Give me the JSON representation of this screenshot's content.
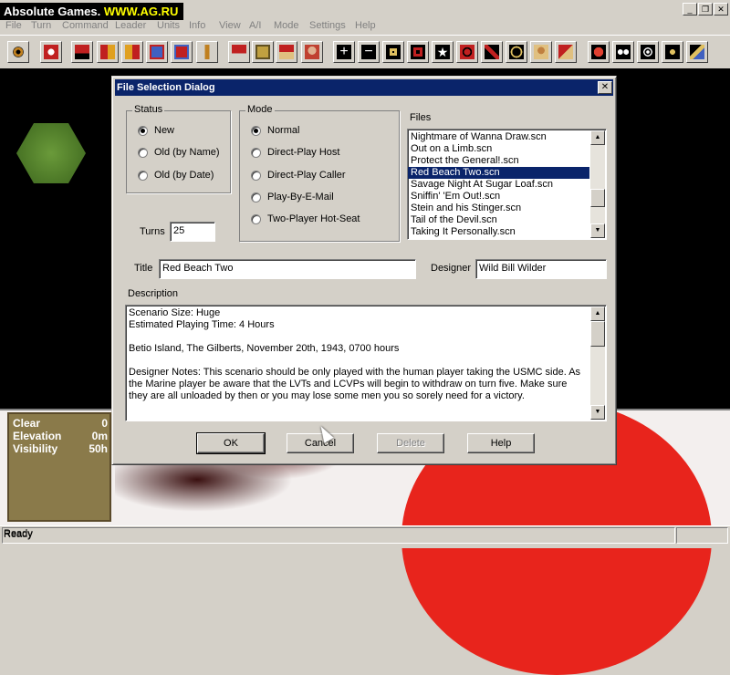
{
  "window": {
    "watermark_part1": "Absolute Games.",
    "watermark_part2": "WWW.AG.RU",
    "min_glyph": "_",
    "max_glyph": "❐",
    "close_glyph": "✕"
  },
  "menu": [
    "File",
    "Turn",
    "Command",
    "Leader",
    "Units",
    "Info",
    "View",
    "A/I",
    "Mode",
    "Settings",
    "Help"
  ],
  "terrain_info": {
    "rows": [
      {
        "label": "Clear",
        "value": "0"
      },
      {
        "label": "Elevation",
        "value": "0m"
      },
      {
        "label": "Visibility",
        "value": "50h"
      }
    ]
  },
  "status": {
    "text": "Ready"
  },
  "dialog": {
    "title": "File Selection Dialog",
    "close_glyph": "✕",
    "status_group": {
      "label": "Status",
      "options": [
        {
          "label": "New",
          "selected": true
        },
        {
          "label": "Old (by Name)",
          "selected": false
        },
        {
          "label": "Old (by Date)",
          "selected": false
        }
      ]
    },
    "mode_group": {
      "label": "Mode",
      "options": [
        {
          "label": "Normal",
          "selected": true
        },
        {
          "label": "Direct-Play Host",
          "selected": false
        },
        {
          "label": "Direct-Play Caller",
          "selected": false
        },
        {
          "label": "Play-By-E-Mail",
          "selected": false
        },
        {
          "label": "Two-Player Hot-Seat",
          "selected": false
        }
      ]
    },
    "files": {
      "label": "Files",
      "items": [
        "Nightmare of Wanna Draw.scn",
        "Out on a Limb.scn",
        "Protect the General!.scn",
        "Red Beach Two.scn",
        "Savage Night At Sugar Loaf.scn",
        "Sniffin' 'Em Out!.scn",
        "Stein and his Stinger.scn",
        "Tail of the Devil.scn",
        "Taking It Personally.scn"
      ],
      "selected": "Red Beach Two.scn"
    },
    "turns": {
      "label": "Turns",
      "value": "25"
    },
    "title_field": {
      "label": "Title",
      "value": "Red Beach Two"
    },
    "designer_field": {
      "label": "Designer",
      "value": "Wild Bill Wilder"
    },
    "description": {
      "label": "Description",
      "lines": [
        "Scenario Size: Huge",
        "Estimated Playing Time: 4 Hours",
        "Betio Island, The Gilberts, November 20th, 1943, 0700 hours",
        "Designer Notes: This scenario should be only played with the human player taking the USMC side. As the Marine player be aware that the LVTs and LCVPs will begin to withdraw on turn five. Make sure they are all unloaded by then or you may lose some men you so sorely need for a victory."
      ]
    },
    "buttons": {
      "ok": "OK",
      "cancel": "Cancel",
      "delete": "Delete",
      "help": "Help"
    },
    "scroll_up_glyph": "▲",
    "scroll_down_glyph": "▼"
  },
  "colors": {
    "title_bar": "#0a246a",
    "selection": "#0a246a",
    "chrome": "#d4d0c8",
    "map_red": "#e8241c"
  }
}
